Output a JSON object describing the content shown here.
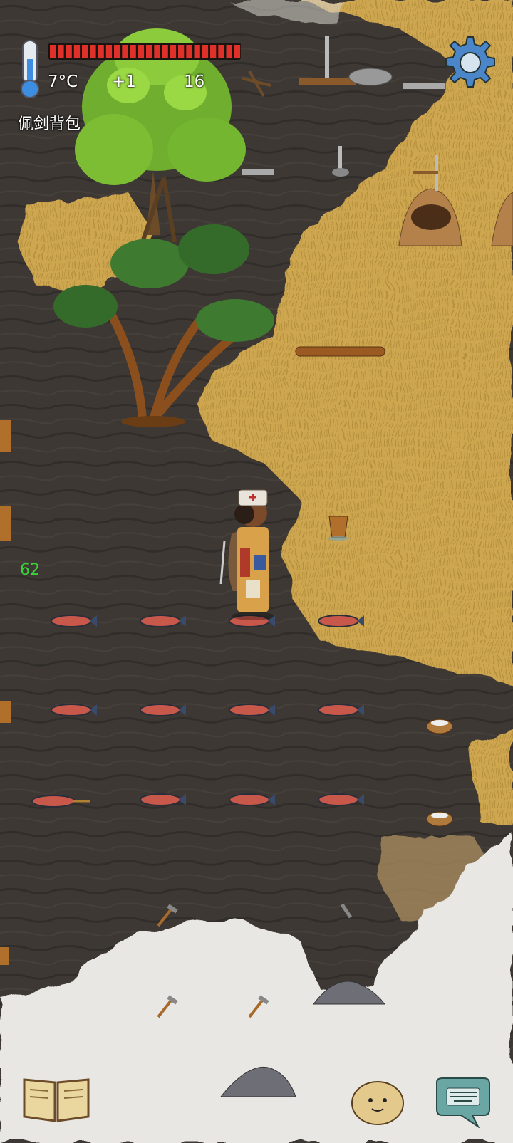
{
  "hud": {
    "temperature": "7°C",
    "modifier": "+1",
    "age": "16",
    "held_item": "佩剑背包",
    "food_meter_segments": 24,
    "food_meter_filled": 24,
    "food_color": "#e0302a"
  },
  "floating": {
    "damage_number": "62",
    "damage_color": "#3ad43a"
  },
  "world": {
    "ground_color": "#3b3632",
    "grass_color": "#caa24a",
    "fog_color": "#e8e6e2",
    "fish_rows": [
      {
        "count": 4
      },
      {
        "count": 4
      },
      {
        "count": 4
      }
    ]
  },
  "buttons": {
    "settings": "settings-gear",
    "recipe_book": "book",
    "emote": "face",
    "keyboard": "keyboard"
  }
}
